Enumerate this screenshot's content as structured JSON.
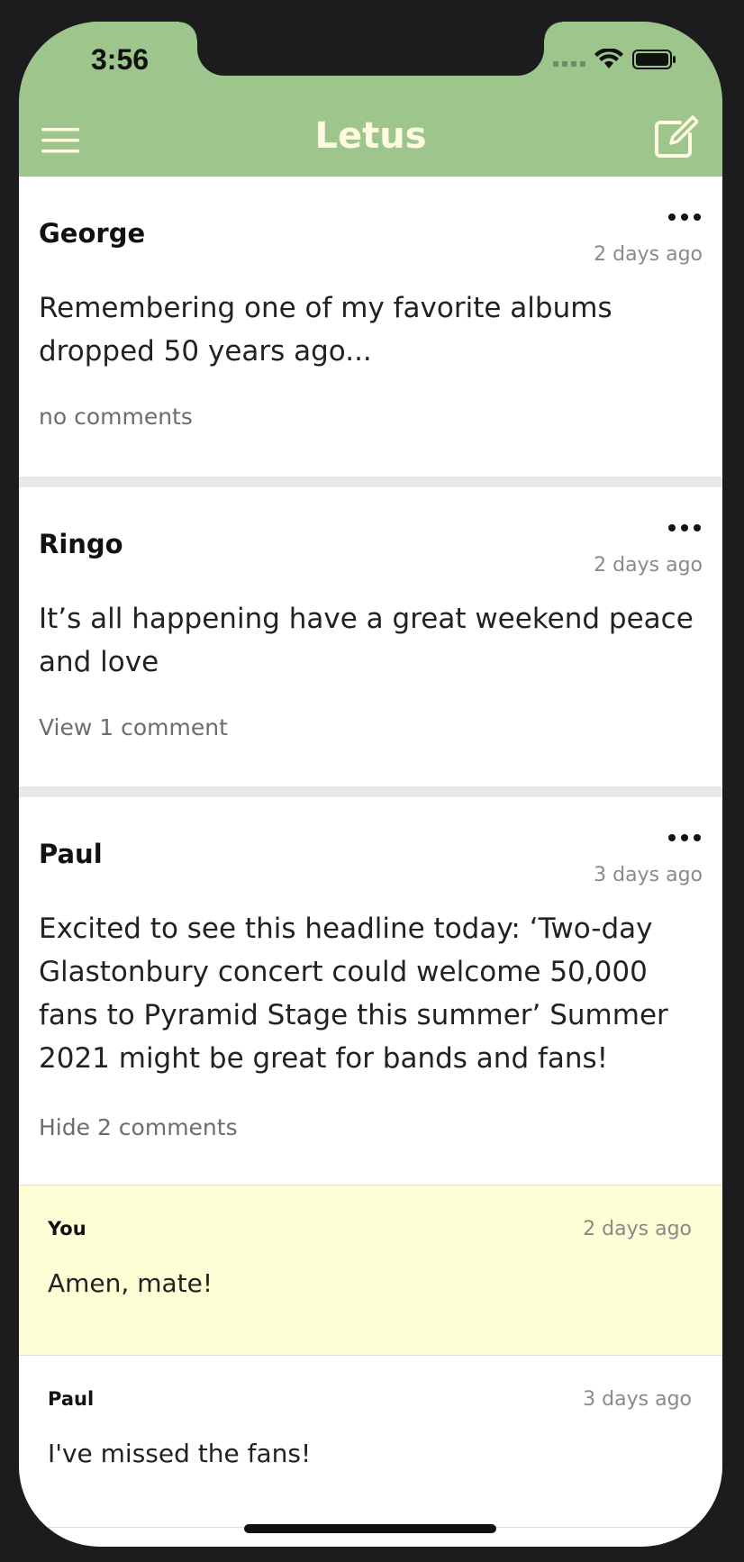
{
  "status_bar": {
    "time": "3:56"
  },
  "header": {
    "title": "Letus",
    "menu_icon": "hamburger-menu-icon",
    "compose_icon": "compose-icon",
    "background_color": "#9dc58c",
    "title_color": "#fffbe0"
  },
  "posts": [
    {
      "author": "George",
      "time": "2 days ago",
      "text": "Remembering one of my favorite albums dropped 50 years ago...",
      "comments_link": "no comments"
    },
    {
      "author": "Ringo",
      "time": "2 days ago",
      "text": "It’s all happening have a great weekend peace and love",
      "comments_link": "View 1 comment"
    },
    {
      "author": "Paul",
      "time": "3 days ago",
      "text": "Excited to see this headline today: ‘Two-day Glastonbury concert could welcome 50,000 fans to Pyramid Stage this summer’  Summer 2021 might be great for bands and fans!",
      "comments_link": "Hide 2 comments",
      "comments": [
        {
          "author": "You",
          "time": "2 days ago",
          "text": "Amen, mate!",
          "highlight_color": "#fefed6"
        },
        {
          "author": "Paul",
          "time": "3 days ago",
          "text": "I've missed the fans!"
        }
      ]
    }
  ]
}
